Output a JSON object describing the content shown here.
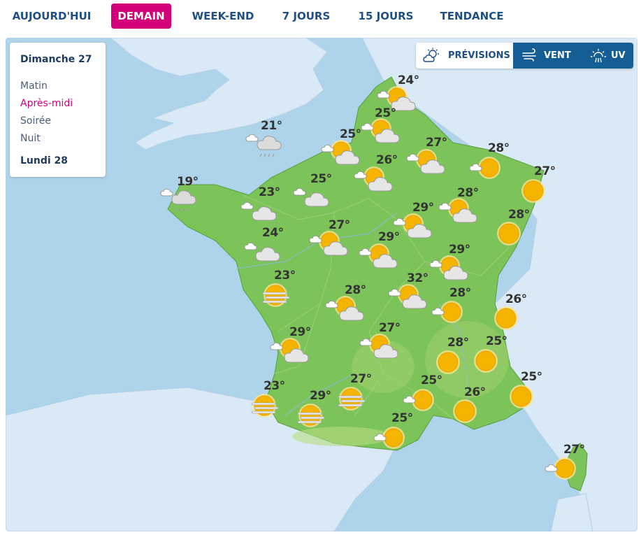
{
  "tabs": [
    {
      "label": "AUJOURD'HUI",
      "active": false
    },
    {
      "label": "DEMAIN",
      "active": true
    },
    {
      "label": "WEEK-END",
      "active": false
    },
    {
      "label": "7 JOURS",
      "active": false
    },
    {
      "label": "15 JOURS",
      "active": false
    },
    {
      "label": "TENDANCE",
      "active": false
    }
  ],
  "panel": {
    "day1": "Dimanche 27",
    "periods": [
      "Matin",
      "Après-midi",
      "Soirée",
      "Nuit"
    ],
    "active_period": "Après-midi",
    "day2": "Lundi 28"
  },
  "layers": {
    "previsions": "PRÉVISIONS",
    "vent": "VENT",
    "uv": "UV",
    "active": "PRÉVISIONS"
  },
  "colors": {
    "accent": "#d4007a",
    "navy": "#1f4f86",
    "sea": "#aed4ec",
    "land": "#7cc35a",
    "sun": "#f5b400"
  },
  "forecast": [
    {
      "temp": "24°",
      "icon": "sun-cloud-icon"
    },
    {
      "temp": "25°",
      "icon": "sun-cloud-icon"
    },
    {
      "temp": "21°",
      "icon": "rain-cloud-icon"
    },
    {
      "temp": "25°",
      "icon": "sun-cloud-icon"
    },
    {
      "temp": "26°",
      "icon": "sun-cloud-icon"
    },
    {
      "temp": "27°",
      "icon": "sun-cloud-icon"
    },
    {
      "temp": "28°",
      "icon": "sun-small-cloud-icon"
    },
    {
      "temp": "27°",
      "icon": "sun-icon"
    },
    {
      "temp": "19°",
      "icon": "rain-cloud-icon"
    },
    {
      "temp": "23°",
      "icon": "cloud-icon"
    },
    {
      "temp": "25°",
      "icon": "cloud-icon"
    },
    {
      "temp": "28°",
      "icon": "sun-cloud-icon"
    },
    {
      "temp": "29°",
      "icon": "sun-cloud-icon"
    },
    {
      "temp": "28°",
      "icon": "sun-icon"
    },
    {
      "temp": "24°",
      "icon": "cloud-icon"
    },
    {
      "temp": "27°",
      "icon": "sun-cloud-icon"
    },
    {
      "temp": "29°",
      "icon": "sun-cloud-icon"
    },
    {
      "temp": "29°",
      "icon": "sun-cloud-icon"
    },
    {
      "temp": "23°",
      "icon": "sun-fog-icon"
    },
    {
      "temp": "28°",
      "icon": "sun-cloud-icon"
    },
    {
      "temp": "32°",
      "icon": "sun-cloud-icon"
    },
    {
      "temp": "28°",
      "icon": "sun-small-cloud-icon"
    },
    {
      "temp": "26°",
      "icon": "sun-icon"
    },
    {
      "temp": "29°",
      "icon": "sun-cloud-icon"
    },
    {
      "temp": "27°",
      "icon": "sun-cloud-icon"
    },
    {
      "temp": "28°",
      "icon": "sun-icon"
    },
    {
      "temp": "25°",
      "icon": "sun-icon"
    },
    {
      "temp": "23°",
      "icon": "sun-fog-icon"
    },
    {
      "temp": "29°",
      "icon": "sun-fog-icon"
    },
    {
      "temp": "27°",
      "icon": "sun-fog-icon"
    },
    {
      "temp": "25°",
      "icon": "sun-small-cloud-icon"
    },
    {
      "temp": "26°",
      "icon": "sun-icon"
    },
    {
      "temp": "25°",
      "icon": "sun-icon"
    },
    {
      "temp": "25°",
      "icon": "sun-small-cloud-icon"
    },
    {
      "temp": "27°",
      "icon": "sun-small-cloud-icon"
    }
  ]
}
